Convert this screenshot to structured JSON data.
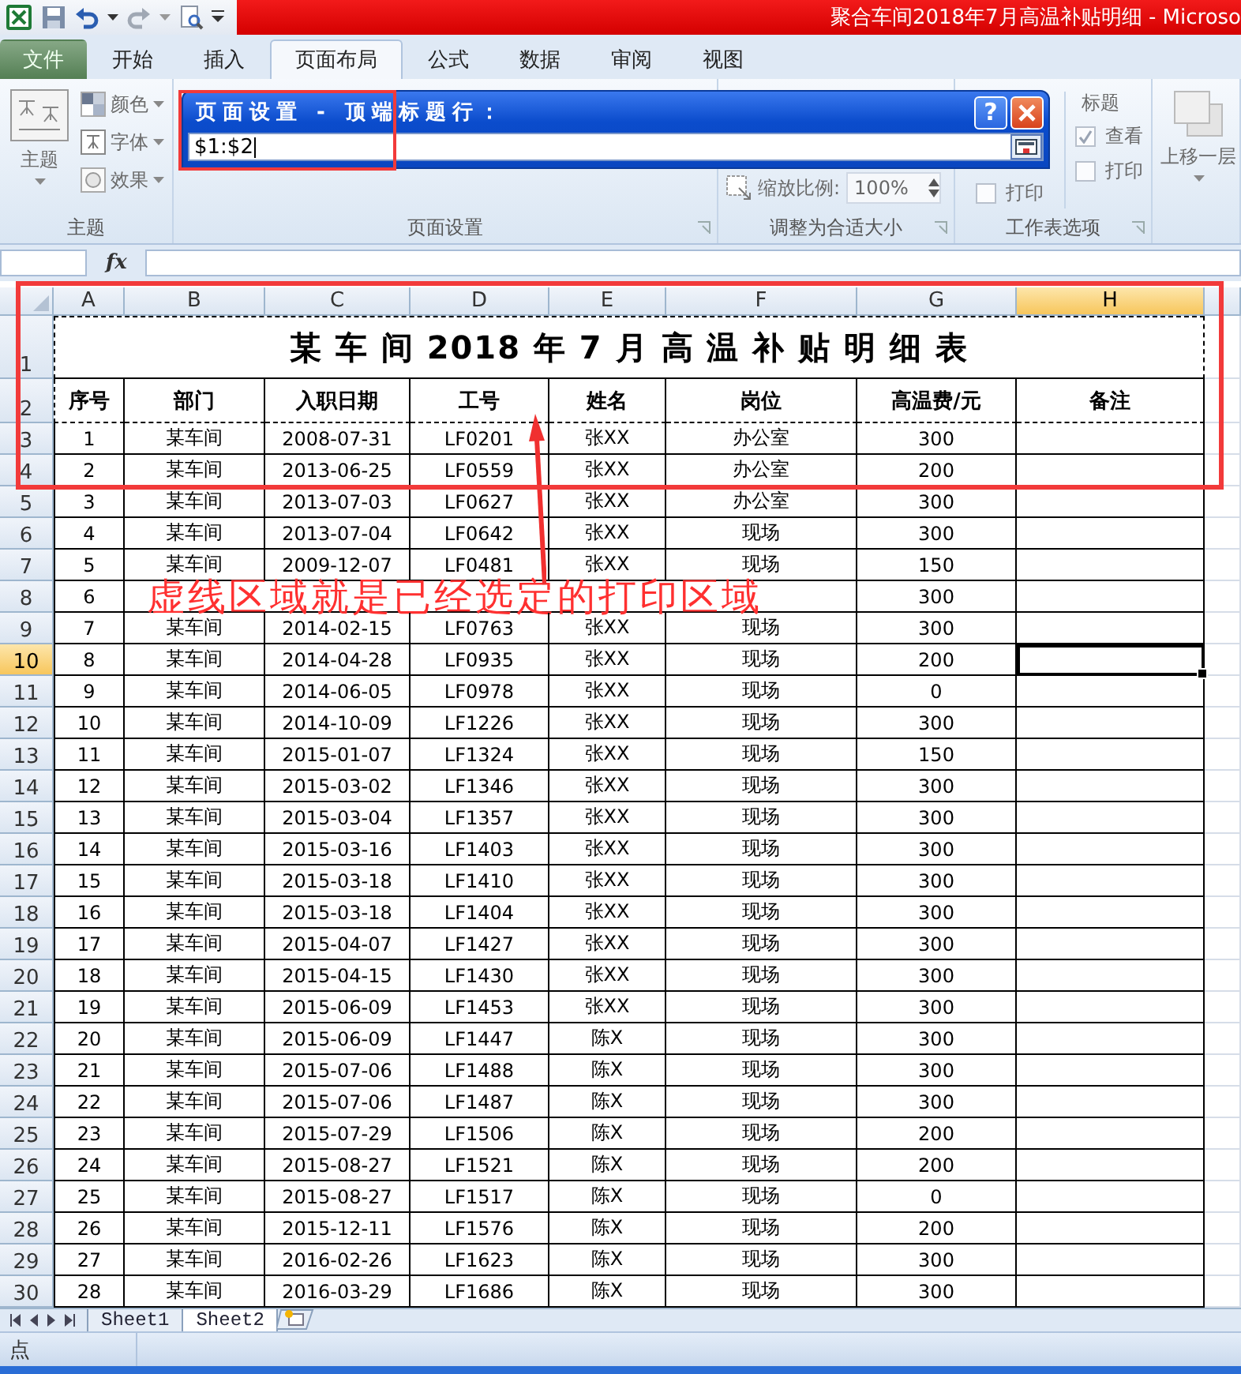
{
  "title_bar": {
    "title": "聚合车间2018年7月高温补贴明细 - Microso"
  },
  "tabs": [
    {
      "label": "文件",
      "kind": "file",
      "selected": false
    },
    {
      "label": "开始",
      "kind": "tab",
      "selected": false
    },
    {
      "label": "插入",
      "kind": "tab",
      "selected": false
    },
    {
      "label": "页面布局",
      "kind": "tab",
      "selected": true
    },
    {
      "label": "公式",
      "kind": "tab",
      "selected": false
    },
    {
      "label": "数据",
      "kind": "tab",
      "selected": false
    },
    {
      "label": "审阅",
      "kind": "tab",
      "selected": false
    },
    {
      "label": "视图",
      "kind": "tab",
      "selected": false
    }
  ],
  "ribbon": {
    "themes": {
      "button": "主题",
      "items": [
        {
          "label": "颜色",
          "kind": "colors"
        },
        {
          "label": "字体",
          "kind": "fonts"
        },
        {
          "label": "效果",
          "kind": "effects"
        }
      ],
      "label": "主题"
    },
    "page_setup": {
      "label": "页面设置"
    },
    "scale_to_fit": {
      "scale_label": "缩放比例:",
      "scale_value": "100%",
      "label": "调整为合适大小"
    },
    "sheet_options": {
      "gridlines": [
        {
          "label": "打印",
          "checked": false
        }
      ],
      "headings": {
        "title": "标题",
        "options": [
          {
            "label": "查看",
            "checked": true
          },
          {
            "label": "打印",
            "checked": false
          }
        ]
      },
      "label": "工作表选项"
    },
    "arrange": {
      "button": "上移一层"
    }
  },
  "dialog": {
    "title": "页面设置 - 顶端标题行：",
    "help_button": "?",
    "value": "$1:$2"
  },
  "formula_bar": {
    "function_label": "fx"
  },
  "sheet": {
    "columns": [
      {
        "label": "A",
        "selected": false
      },
      {
        "label": "B",
        "selected": false
      },
      {
        "label": "C",
        "selected": false
      },
      {
        "label": "D",
        "selected": false
      },
      {
        "label": "E",
        "selected": false
      },
      {
        "label": "F",
        "selected": false
      },
      {
        "label": "G",
        "selected": false
      },
      {
        "label": "H",
        "selected": true
      }
    ],
    "title_row": {
      "row_number": "1",
      "text": "某 车 间 2018 年 7 月 高 温 补 贴 明 细 表"
    },
    "header_row": {
      "row_number": "2",
      "cells": [
        "序号",
        "部门",
        "入职日期",
        "工号",
        "姓名",
        "岗位",
        "高温费/元",
        "备注"
      ]
    },
    "rows": [
      {
        "row_number": "3",
        "selected": false,
        "cells": [
          "1",
          "某车间",
          "2008-07-31",
          "LF0201",
          "张XX",
          "办公室",
          "300"
        ]
      },
      {
        "row_number": "4",
        "selected": false,
        "cells": [
          "2",
          "某车间",
          "2013-06-25",
          "LF0559",
          "张XX",
          "办公室",
          "200"
        ]
      },
      {
        "row_number": "5",
        "selected": false,
        "cells": [
          "3",
          "某车间",
          "2013-07-03",
          "LF0627",
          "张XX",
          "办公室",
          "300"
        ]
      },
      {
        "row_number": "6",
        "selected": false,
        "cells": [
          "4",
          "某车间",
          "2013-07-04",
          "LF0642",
          "张XX",
          "现场",
          "300"
        ]
      },
      {
        "row_number": "7",
        "selected": false,
        "cells": [
          "5",
          "某车间",
          "2009-12-07",
          "LF0481",
          "张XX",
          "现场",
          "150"
        ]
      },
      {
        "row_number": "8",
        "selected": false,
        "cells": [
          "6",
          null,
          null,
          null,
          null,
          null,
          "300"
        ]
      },
      {
        "row_number": "9",
        "selected": false,
        "cells": [
          "7",
          "某车间",
          "2014-02-15",
          "LF0763",
          "张XX",
          "现场",
          "300"
        ]
      },
      {
        "row_number": "10",
        "selected": true,
        "cells": [
          "8",
          "某车间",
          "2014-04-28",
          "LF0935",
          "张XX",
          "现场",
          "200"
        ]
      },
      {
        "row_number": "11",
        "selected": false,
        "cells": [
          "9",
          "某车间",
          "2014-06-05",
          "LF0978",
          "张XX",
          "现场",
          "0"
        ]
      },
      {
        "row_number": "12",
        "selected": false,
        "cells": [
          "10",
          "某车间",
          "2014-10-09",
          "LF1226",
          "张XX",
          "现场",
          "300"
        ]
      },
      {
        "row_number": "13",
        "selected": false,
        "cells": [
          "11",
          "某车间",
          "2015-01-07",
          "LF1324",
          "张XX",
          "现场",
          "150"
        ]
      },
      {
        "row_number": "14",
        "selected": false,
        "cells": [
          "12",
          "某车间",
          "2015-03-02",
          "LF1346",
          "张XX",
          "现场",
          "300"
        ]
      },
      {
        "row_number": "15",
        "selected": false,
        "cells": [
          "13",
          "某车间",
          "2015-03-04",
          "LF1357",
          "张XX",
          "现场",
          "300"
        ]
      },
      {
        "row_number": "16",
        "selected": false,
        "cells": [
          "14",
          "某车间",
          "2015-03-16",
          "LF1403",
          "张XX",
          "现场",
          "300"
        ]
      },
      {
        "row_number": "17",
        "selected": false,
        "cells": [
          "15",
          "某车间",
          "2015-03-18",
          "LF1410",
          "张XX",
          "现场",
          "300"
        ]
      },
      {
        "row_number": "18",
        "selected": false,
        "cells": [
          "16",
          "某车间",
          "2015-03-18",
          "LF1404",
          "张XX",
          "现场",
          "300"
        ]
      },
      {
        "row_number": "19",
        "selected": false,
        "cells": [
          "17",
          "某车间",
          "2015-04-07",
          "LF1427",
          "张XX",
          "现场",
          "300"
        ]
      },
      {
        "row_number": "20",
        "selected": false,
        "cells": [
          "18",
          "某车间",
          "2015-04-15",
          "LF1430",
          "张XX",
          "现场",
          "300"
        ]
      },
      {
        "row_number": "21",
        "selected": false,
        "cells": [
          "19",
          "某车间",
          "2015-06-09",
          "LF1453",
          "张XX",
          "现场",
          "300"
        ]
      },
      {
        "row_number": "22",
        "selected": false,
        "cells": [
          "20",
          "某车间",
          "2015-06-09",
          "LF1447",
          "陈X",
          "现场",
          "300"
        ]
      },
      {
        "row_number": "23",
        "selected": false,
        "cells": [
          "21",
          "某车间",
          "2015-07-06",
          "LF1488",
          "陈X",
          "现场",
          "300"
        ]
      },
      {
        "row_number": "24",
        "selected": false,
        "cells": [
          "22",
          "某车间",
          "2015-07-06",
          "LF1487",
          "陈X",
          "现场",
          "300"
        ]
      },
      {
        "row_number": "25",
        "selected": false,
        "cells": [
          "23",
          "某车间",
          "2015-07-29",
          "LF1506",
          "陈X",
          "现场",
          "200"
        ]
      },
      {
        "row_number": "26",
        "selected": false,
        "cells": [
          "24",
          "某车间",
          "2015-08-27",
          "LF1521",
          "陈X",
          "现场",
          "200"
        ]
      },
      {
        "row_number": "27",
        "selected": false,
        "cells": [
          "25",
          "某车间",
          "2015-08-27",
          "LF1517",
          "陈X",
          "现场",
          "0"
        ]
      },
      {
        "row_number": "28",
        "selected": false,
        "cells": [
          "26",
          "某车间",
          "2015-12-11",
          "LF1576",
          "陈X",
          "现场",
          "200"
        ]
      },
      {
        "row_number": "29",
        "selected": false,
        "cells": [
          "27",
          "某车间",
          "2016-02-26",
          "LF1623",
          "陈X",
          "现场",
          "300"
        ]
      },
      {
        "row_number": "30",
        "selected": false,
        "cells": [
          "28",
          "某车间",
          "2016-03-29",
          "LF1686",
          "陈X",
          "现场",
          "300"
        ]
      }
    ]
  },
  "annotation": "虚线区域就是已经选定的打印区域",
  "sheet_tabs": [
    {
      "label": "Sheet1",
      "selected": false
    },
    {
      "label": "Sheet2",
      "selected": true
    }
  ],
  "status_bar": {
    "text": "点"
  }
}
